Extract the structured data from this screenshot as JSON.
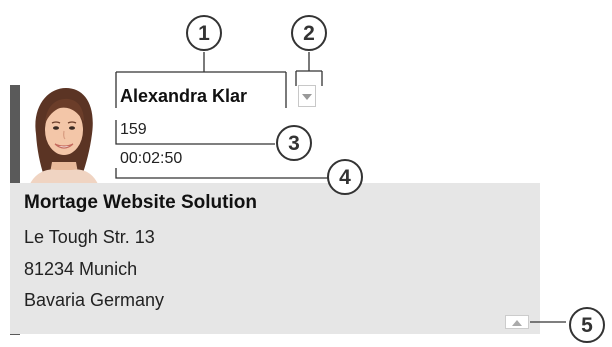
{
  "contact": {
    "name": "Alexandra Klar",
    "extension": "159",
    "duration": "00:02:50"
  },
  "company": {
    "name": "Mortage Website Solution",
    "street": "Le Tough Str. 13",
    "city": "81234 Munich",
    "region": "Bavaria Germany"
  },
  "callouts": [
    "1",
    "2",
    "3",
    "4",
    "5"
  ],
  "icons": {
    "dropdown": "chevron-down-icon",
    "collapse": "chevron-up-icon",
    "avatar": "contact-photo"
  },
  "colors": {
    "panel": "#e6e6e6",
    "accent_bar": "#5a5a5a",
    "callout": "#333333"
  }
}
